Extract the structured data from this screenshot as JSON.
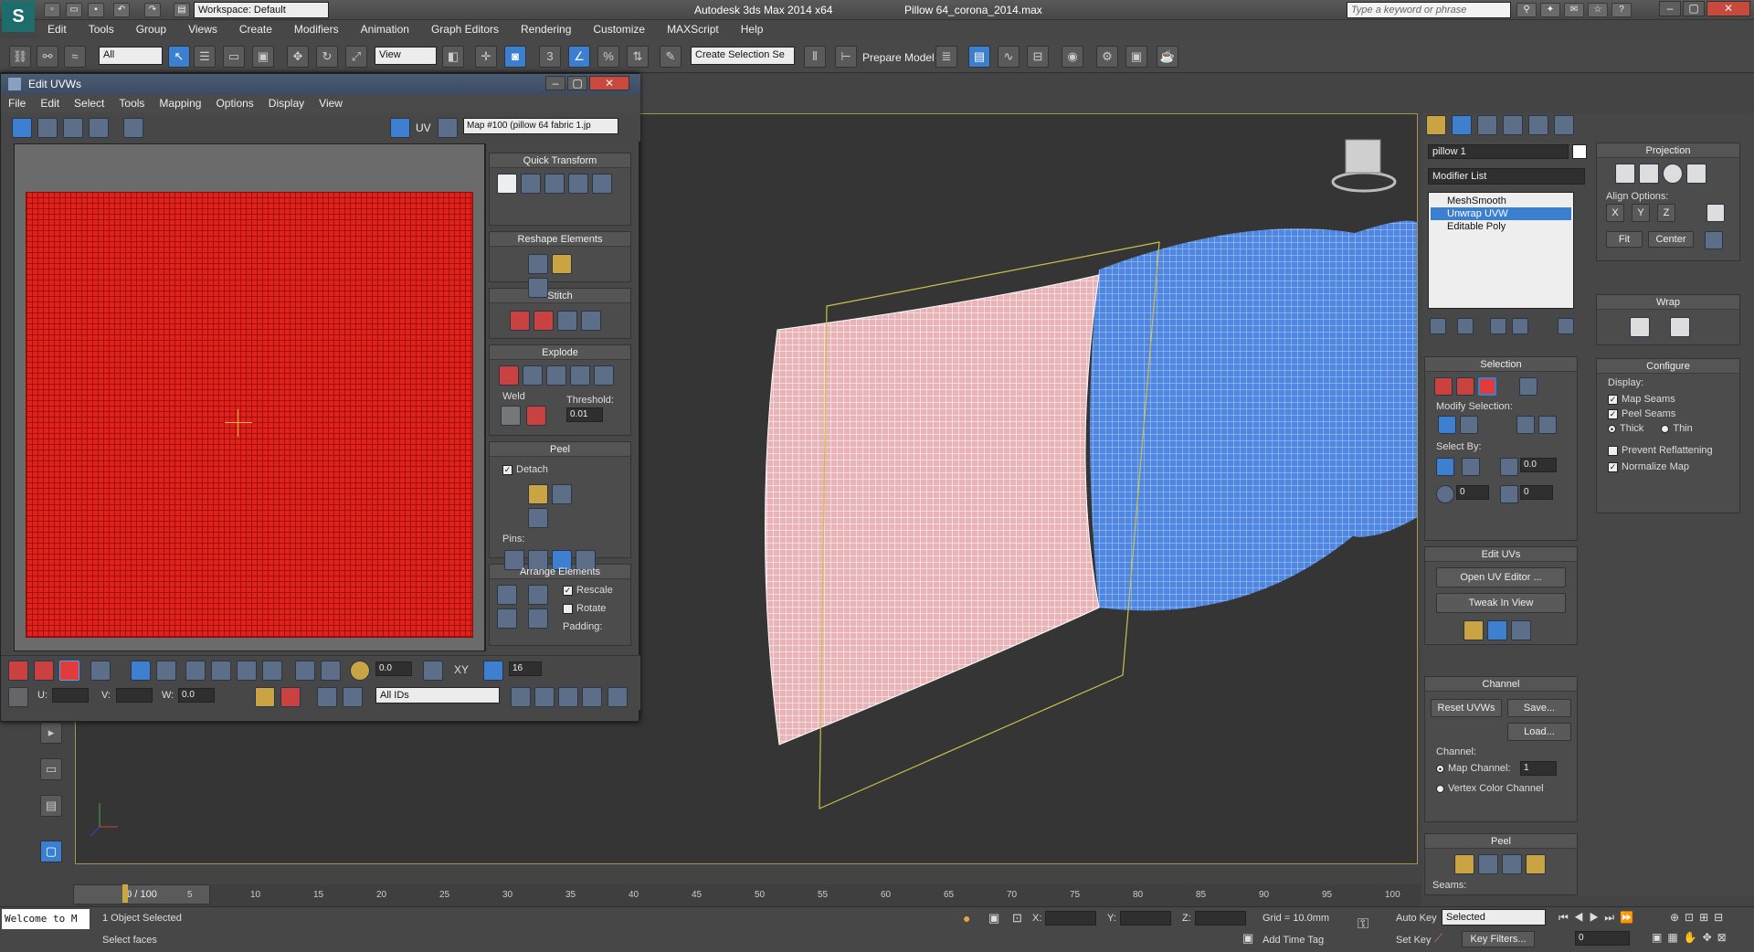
{
  "titlebar": {
    "workspace": "Workspace: Default",
    "app_title": "Autodesk 3ds Max  2014 x64",
    "file_title": "Pillow 64_corona_2014.max",
    "search_placeholder": "Type a keyword or phrase"
  },
  "menubar": [
    "Edit",
    "Tools",
    "Group",
    "Views",
    "Create",
    "Modifiers",
    "Animation",
    "Graph Editors",
    "Rendering",
    "Customize",
    "MAXScript",
    "Help"
  ],
  "toolbar": {
    "filter_value": "All",
    "refcoord_value": "View",
    "selection_set": "Create Selection Se",
    "prepare_model": "Prepare Model",
    "snap_number": "3"
  },
  "uv_window": {
    "title": "Edit UVWs",
    "menu": [
      "File",
      "Edit",
      "Select",
      "Tools",
      "Mapping",
      "Options",
      "Display",
      "View"
    ],
    "uv_label": "UV",
    "map_dropdown": "Map #100 (pillow 64 fabric 1.jp",
    "quick_transform": "Quick Transform",
    "reshape_elements": "Reshape Elements",
    "stitch": "Stitch",
    "explode": "Explode",
    "weld": "Weld",
    "threshold_label": "Threshold:",
    "threshold_value": "0.01",
    "peel": "Peel",
    "detach": "Detach",
    "pins": "Pins:",
    "arrange_elements": "Arrange Elements",
    "rescale": "Rescale",
    "rotate": "Rotate",
    "padding": "Padding:",
    "bottom_value1": "0.0",
    "bottom_xy": "XY",
    "bottom_value2": "16",
    "u_label": "U:",
    "v_label": "V:",
    "w_label": "W:",
    "w_value": "0.0",
    "ids_dropdown": "All IDs"
  },
  "command_panel": {
    "object_name": "pillow 1",
    "modifier_list": "Modifier List",
    "stack": [
      "MeshSmooth",
      "Unwrap UVW",
      "Editable Poly"
    ],
    "selection_header": "Selection",
    "modify_selection": "Modify Selection:",
    "select_by": "Select By:",
    "spin_a": "0.0",
    "spin_b": "0",
    "spin_c": "0",
    "edit_uvs_header": "Edit UVs",
    "open_uv_editor": "Open UV Editor ...",
    "tweak_in_view": "Tweak In View",
    "channel_header": "Channel",
    "reset_uvws": "Reset UVWs",
    "save": "Save...",
    "load": "Load...",
    "channel_label": "Channel:",
    "map_channel": "Map Channel:",
    "map_channel_value": "1",
    "vertex_color_channel": "Vertex Color Channel",
    "peel_header": "Peel",
    "seams": "Seams:",
    "projection_header": "Projection",
    "align_options": "Align Options:",
    "align_x": "X",
    "align_y": "Y",
    "align_z": "Z",
    "fit": "Fit",
    "center": "Center",
    "wrap_header": "Wrap",
    "configure_header": "Configure",
    "display_label": "Display:",
    "map_seams": "Map Seams",
    "peel_seams": "Peel Seams",
    "thick": "Thick",
    "thin": "Thin",
    "prevent_reflattening": "Prevent Reflattening",
    "normalize_map": "Normalize Map"
  },
  "timeline": {
    "frame": "0 / 100",
    "ticks": [
      "0",
      "5",
      "10",
      "15",
      "20",
      "25",
      "30",
      "35",
      "40",
      "45",
      "50",
      "55",
      "60",
      "65",
      "70",
      "75",
      "80",
      "85",
      "90",
      "95",
      "100"
    ]
  },
  "status": {
    "maxscript": "Welcome to M",
    "selected": "1 Object Selected",
    "prompt": "Select faces",
    "x_label": "X:",
    "y_label": "Y:",
    "z_label": "Z:",
    "grid": "Grid = 10.0mm",
    "add_time_tag": "Add Time Tag",
    "auto_key": "Auto Key",
    "auto_key_mode": "Selected",
    "set_key": "Set Key",
    "key_filters": "Key Filters...",
    "frame_value": "0"
  },
  "colors": {
    "accent": "#3b7fd1",
    "uv_red": "#e0221d",
    "viewport_border": "#a39650",
    "pillow_blue": "#4f86e0"
  }
}
